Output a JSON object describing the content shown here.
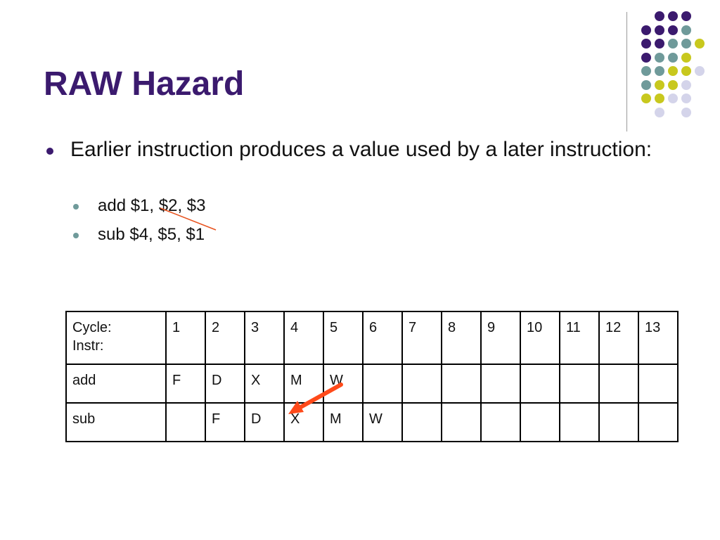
{
  "slide": {
    "title": "RAW Hazard",
    "bullet": "Earlier instruction produces a value used by a later instruction:",
    "sub_bullets": [
      "add $1, $2, $3",
      "sub $4, $5, $1"
    ]
  },
  "colors": {
    "title": "#3b1a6e",
    "dot_purple": "#3b1a6e",
    "dot_teal": "#6f9a9a",
    "dot_yellow": "#c8c81e",
    "dot_lavender": "#d4d4ea",
    "hazard_line": "#e8531f",
    "arrow": "#ff4a1a"
  },
  "table": {
    "header": {
      "label": [
        "Cycle:",
        "Instr:"
      ],
      "cycles": [
        "1",
        "2",
        "3",
        "4",
        "5",
        "6",
        "7",
        "8",
        "9",
        "10",
        "11",
        "12",
        "13"
      ]
    },
    "rows": [
      {
        "instr": "add",
        "stages": [
          "F",
          "D",
          "X",
          "M",
          "W",
          "",
          "",
          "",
          "",
          "",
          "",
          "",
          ""
        ]
      },
      {
        "instr": "sub",
        "stages": [
          "",
          "F",
          "D",
          "X",
          "M",
          "W",
          "",
          "",
          "",
          "",
          "",
          "",
          ""
        ]
      }
    ]
  }
}
